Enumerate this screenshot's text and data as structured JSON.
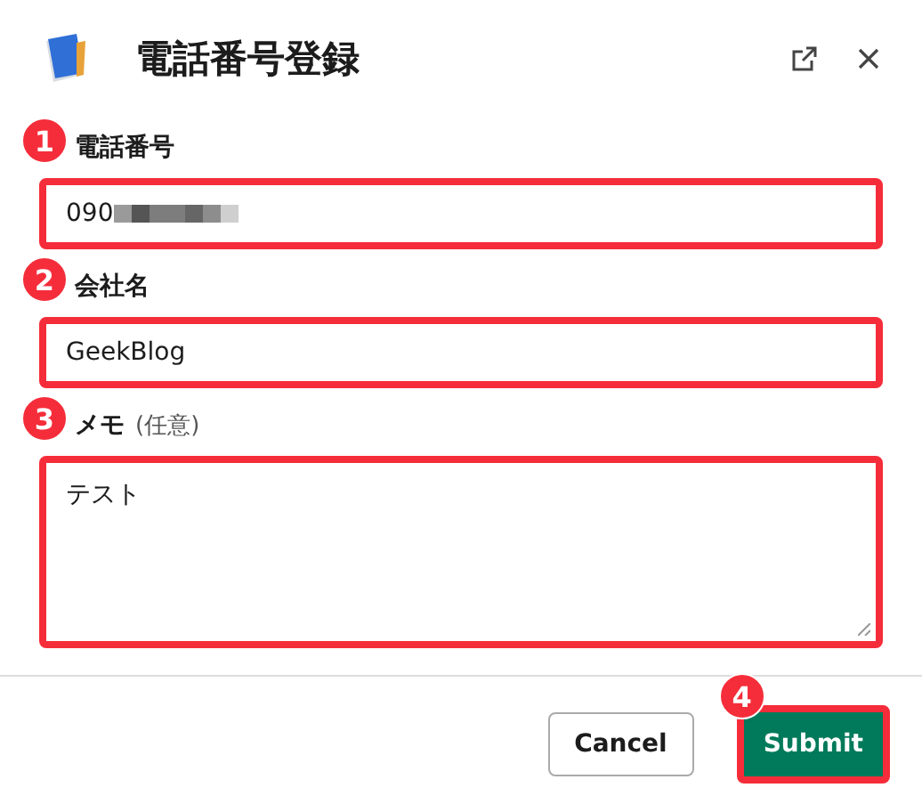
{
  "dialog": {
    "title": "電話番号登録"
  },
  "fields": [
    {
      "kind": "input",
      "label": "電話番号",
      "value": "090",
      "redacted": true,
      "badge": "1",
      "highlighted": true
    },
    {
      "kind": "input",
      "label": "会社名",
      "value": "GeekBlog",
      "redacted": false,
      "badge": "2",
      "highlighted": true
    },
    {
      "kind": "textarea",
      "label": "メモ",
      "hint": "(任意)",
      "value": "テスト",
      "badge": "3",
      "highlighted": true
    }
  ],
  "buttons": [
    {
      "kind": "secondary",
      "label": "Cancel",
      "highlighted": false
    },
    {
      "kind": "primary",
      "label": "Submit",
      "badge": "4",
      "highlighted": true
    }
  ]
}
